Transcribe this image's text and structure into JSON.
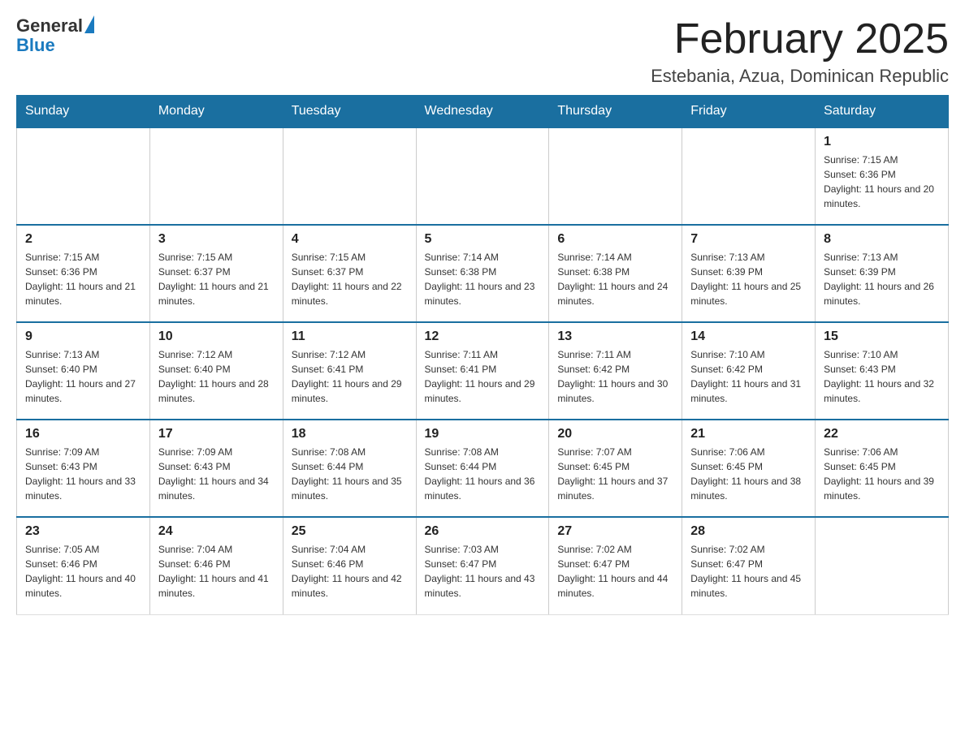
{
  "logo": {
    "text_general": "General",
    "text_blue": "Blue"
  },
  "title": {
    "month_year": "February 2025",
    "location": "Estebania, Azua, Dominican Republic"
  },
  "weekdays": [
    "Sunday",
    "Monday",
    "Tuesday",
    "Wednesday",
    "Thursday",
    "Friday",
    "Saturday"
  ],
  "weeks": [
    [
      {
        "day": "",
        "sunrise": "",
        "sunset": "",
        "daylight": ""
      },
      {
        "day": "",
        "sunrise": "",
        "sunset": "",
        "daylight": ""
      },
      {
        "day": "",
        "sunrise": "",
        "sunset": "",
        "daylight": ""
      },
      {
        "day": "",
        "sunrise": "",
        "sunset": "",
        "daylight": ""
      },
      {
        "day": "",
        "sunrise": "",
        "sunset": "",
        "daylight": ""
      },
      {
        "day": "",
        "sunrise": "",
        "sunset": "",
        "daylight": ""
      },
      {
        "day": "1",
        "sunrise": "Sunrise: 7:15 AM",
        "sunset": "Sunset: 6:36 PM",
        "daylight": "Daylight: 11 hours and 20 minutes."
      }
    ],
    [
      {
        "day": "2",
        "sunrise": "Sunrise: 7:15 AM",
        "sunset": "Sunset: 6:36 PM",
        "daylight": "Daylight: 11 hours and 21 minutes."
      },
      {
        "day": "3",
        "sunrise": "Sunrise: 7:15 AM",
        "sunset": "Sunset: 6:37 PM",
        "daylight": "Daylight: 11 hours and 21 minutes."
      },
      {
        "day": "4",
        "sunrise": "Sunrise: 7:15 AM",
        "sunset": "Sunset: 6:37 PM",
        "daylight": "Daylight: 11 hours and 22 minutes."
      },
      {
        "day": "5",
        "sunrise": "Sunrise: 7:14 AM",
        "sunset": "Sunset: 6:38 PM",
        "daylight": "Daylight: 11 hours and 23 minutes."
      },
      {
        "day": "6",
        "sunrise": "Sunrise: 7:14 AM",
        "sunset": "Sunset: 6:38 PM",
        "daylight": "Daylight: 11 hours and 24 minutes."
      },
      {
        "day": "7",
        "sunrise": "Sunrise: 7:13 AM",
        "sunset": "Sunset: 6:39 PM",
        "daylight": "Daylight: 11 hours and 25 minutes."
      },
      {
        "day": "8",
        "sunrise": "Sunrise: 7:13 AM",
        "sunset": "Sunset: 6:39 PM",
        "daylight": "Daylight: 11 hours and 26 minutes."
      }
    ],
    [
      {
        "day": "9",
        "sunrise": "Sunrise: 7:13 AM",
        "sunset": "Sunset: 6:40 PM",
        "daylight": "Daylight: 11 hours and 27 minutes."
      },
      {
        "day": "10",
        "sunrise": "Sunrise: 7:12 AM",
        "sunset": "Sunset: 6:40 PM",
        "daylight": "Daylight: 11 hours and 28 minutes."
      },
      {
        "day": "11",
        "sunrise": "Sunrise: 7:12 AM",
        "sunset": "Sunset: 6:41 PM",
        "daylight": "Daylight: 11 hours and 29 minutes."
      },
      {
        "day": "12",
        "sunrise": "Sunrise: 7:11 AM",
        "sunset": "Sunset: 6:41 PM",
        "daylight": "Daylight: 11 hours and 29 minutes."
      },
      {
        "day": "13",
        "sunrise": "Sunrise: 7:11 AM",
        "sunset": "Sunset: 6:42 PM",
        "daylight": "Daylight: 11 hours and 30 minutes."
      },
      {
        "day": "14",
        "sunrise": "Sunrise: 7:10 AM",
        "sunset": "Sunset: 6:42 PM",
        "daylight": "Daylight: 11 hours and 31 minutes."
      },
      {
        "day": "15",
        "sunrise": "Sunrise: 7:10 AM",
        "sunset": "Sunset: 6:43 PM",
        "daylight": "Daylight: 11 hours and 32 minutes."
      }
    ],
    [
      {
        "day": "16",
        "sunrise": "Sunrise: 7:09 AM",
        "sunset": "Sunset: 6:43 PM",
        "daylight": "Daylight: 11 hours and 33 minutes."
      },
      {
        "day": "17",
        "sunrise": "Sunrise: 7:09 AM",
        "sunset": "Sunset: 6:43 PM",
        "daylight": "Daylight: 11 hours and 34 minutes."
      },
      {
        "day": "18",
        "sunrise": "Sunrise: 7:08 AM",
        "sunset": "Sunset: 6:44 PM",
        "daylight": "Daylight: 11 hours and 35 minutes."
      },
      {
        "day": "19",
        "sunrise": "Sunrise: 7:08 AM",
        "sunset": "Sunset: 6:44 PM",
        "daylight": "Daylight: 11 hours and 36 minutes."
      },
      {
        "day": "20",
        "sunrise": "Sunrise: 7:07 AM",
        "sunset": "Sunset: 6:45 PM",
        "daylight": "Daylight: 11 hours and 37 minutes."
      },
      {
        "day": "21",
        "sunrise": "Sunrise: 7:06 AM",
        "sunset": "Sunset: 6:45 PM",
        "daylight": "Daylight: 11 hours and 38 minutes."
      },
      {
        "day": "22",
        "sunrise": "Sunrise: 7:06 AM",
        "sunset": "Sunset: 6:45 PM",
        "daylight": "Daylight: 11 hours and 39 minutes."
      }
    ],
    [
      {
        "day": "23",
        "sunrise": "Sunrise: 7:05 AM",
        "sunset": "Sunset: 6:46 PM",
        "daylight": "Daylight: 11 hours and 40 minutes."
      },
      {
        "day": "24",
        "sunrise": "Sunrise: 7:04 AM",
        "sunset": "Sunset: 6:46 PM",
        "daylight": "Daylight: 11 hours and 41 minutes."
      },
      {
        "day": "25",
        "sunrise": "Sunrise: 7:04 AM",
        "sunset": "Sunset: 6:46 PM",
        "daylight": "Daylight: 11 hours and 42 minutes."
      },
      {
        "day": "26",
        "sunrise": "Sunrise: 7:03 AM",
        "sunset": "Sunset: 6:47 PM",
        "daylight": "Daylight: 11 hours and 43 minutes."
      },
      {
        "day": "27",
        "sunrise": "Sunrise: 7:02 AM",
        "sunset": "Sunset: 6:47 PM",
        "daylight": "Daylight: 11 hours and 44 minutes."
      },
      {
        "day": "28",
        "sunrise": "Sunrise: 7:02 AM",
        "sunset": "Sunset: 6:47 PM",
        "daylight": "Daylight: 11 hours and 45 minutes."
      },
      {
        "day": "",
        "sunrise": "",
        "sunset": "",
        "daylight": ""
      }
    ]
  ]
}
